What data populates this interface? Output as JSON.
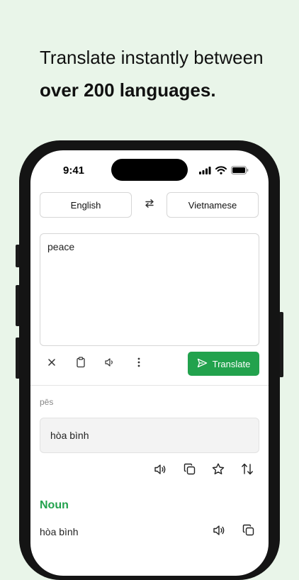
{
  "headline": {
    "line1": "Translate instantly between",
    "line2": "over 200 languages."
  },
  "status_bar": {
    "time": "9:41",
    "icons": [
      "signal-icon",
      "wifi-icon",
      "battery-icon"
    ]
  },
  "language_bar": {
    "source": "English",
    "target": "Vietnamese",
    "swap_icon": "swap-arrows-icon"
  },
  "input": {
    "text": "peace"
  },
  "input_tools": [
    "clear-icon",
    "clipboard-icon",
    "speaker-icon",
    "more-icon"
  ],
  "translate_button": {
    "label": "Translate",
    "icon": "send-icon"
  },
  "result": {
    "pronunciation": "pēs",
    "text": "hòa bình",
    "actions": [
      "speaker-icon",
      "copy-icon",
      "star-icon",
      "swap-vertical-icon"
    ]
  },
  "dictionary": {
    "part_of_speech": "Noun",
    "entry": "hòa bình"
  },
  "colors": {
    "background": "#e9f5e9",
    "accent": "#22a24d"
  }
}
